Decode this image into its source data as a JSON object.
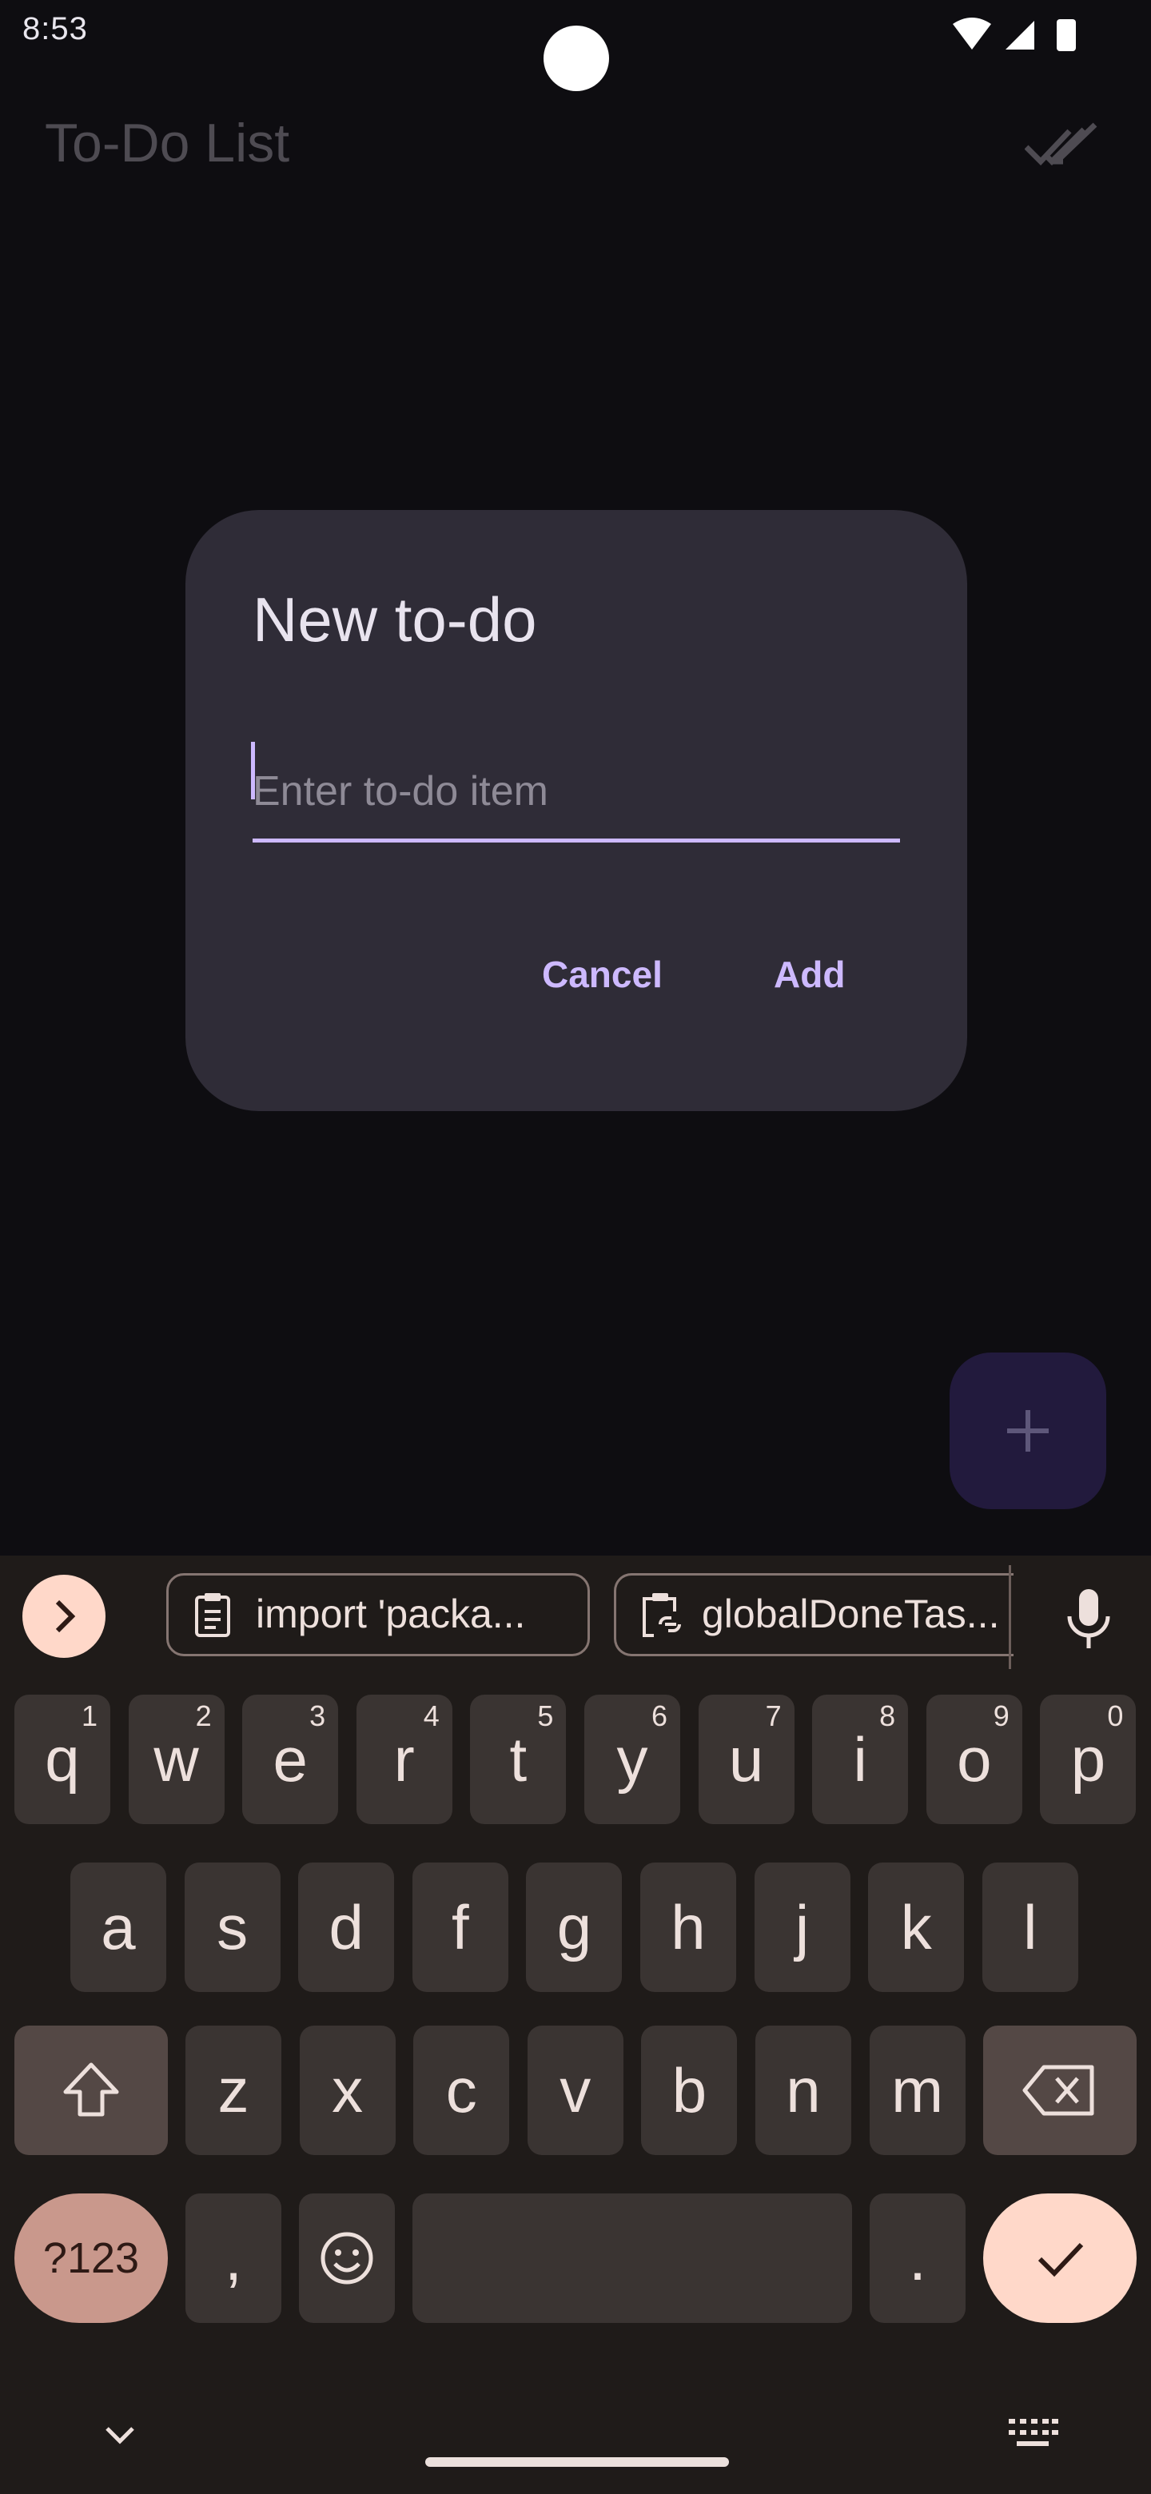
{
  "status_bar": {
    "time": "8:53"
  },
  "app_bar": {
    "title": "To-Do List"
  },
  "dialog": {
    "title": "New to-do",
    "input_placeholder": "Enter to-do item",
    "input_value": "",
    "cancel_label": "Cancel",
    "add_label": "Add"
  },
  "fab": {
    "icon": "plus-icon"
  },
  "keyboard": {
    "clipboard_chips": [
      "import 'packa...",
      "globalDoneTas..."
    ],
    "row1": [
      {
        "key": "q",
        "hint": "1"
      },
      {
        "key": "w",
        "hint": "2"
      },
      {
        "key": "e",
        "hint": "3"
      },
      {
        "key": "r",
        "hint": "4"
      },
      {
        "key": "t",
        "hint": "5"
      },
      {
        "key": "y",
        "hint": "6"
      },
      {
        "key": "u",
        "hint": "7"
      },
      {
        "key": "i",
        "hint": "8"
      },
      {
        "key": "o",
        "hint": "9"
      },
      {
        "key": "p",
        "hint": "0"
      }
    ],
    "row2": [
      "a",
      "s",
      "d",
      "f",
      "g",
      "h",
      "j",
      "k",
      "l"
    ],
    "row3": [
      "z",
      "x",
      "c",
      "v",
      "b",
      "n",
      "m"
    ],
    "sym_label": "?123",
    "comma": ",",
    "period": "."
  },
  "colors": {
    "background": "#0e0d11",
    "dialog": "#2f2c37",
    "accent": "#cdb9ff",
    "keyboard": "#1f1b19",
    "key": "#3a3432",
    "enter_key": "#ffd8c9"
  }
}
